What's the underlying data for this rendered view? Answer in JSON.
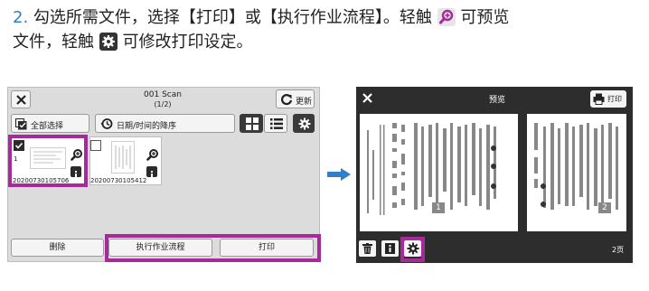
{
  "instruction": {
    "step": "2.",
    "line1_a": "勾选所需文件，选择【打印】或【执行作业流程】。轻触",
    "line1_b": "可预览",
    "line2_a": "文件，轻触",
    "line2_b": "可修改打印设定。"
  },
  "left_panel": {
    "title": "001 Scan",
    "subtitle": "(1/2)",
    "refresh_label": "更新",
    "select_all_label": "全部选择",
    "sort_label": "日期/时间的降序",
    "files": [
      {
        "index": "1",
        "name": "20200730105706",
        "checked": true
      },
      {
        "index": "",
        "name": "20200730105412",
        "checked": false
      }
    ],
    "delete_label": "删除",
    "workflow_label": "执行作业流程",
    "print_label": "打印"
  },
  "right_panel": {
    "title": "预览",
    "print_label": "打印",
    "page1_num": "1",
    "page2_num": "2",
    "page_count": "2页"
  },
  "colors": {
    "highlight": "#a7299a",
    "step_number": "#2f7fcb",
    "arrow": "#2f7fcb",
    "preview_bg": "#2d2d2d"
  },
  "icons": [
    "zoom-icon",
    "gear-icon",
    "close-icon",
    "refresh-icon",
    "select-all-icon",
    "sort-clock-icon",
    "grid-view-icon",
    "list-view-icon",
    "info-icon",
    "printer-icon",
    "trash-icon",
    "right-arrow-icon"
  ]
}
